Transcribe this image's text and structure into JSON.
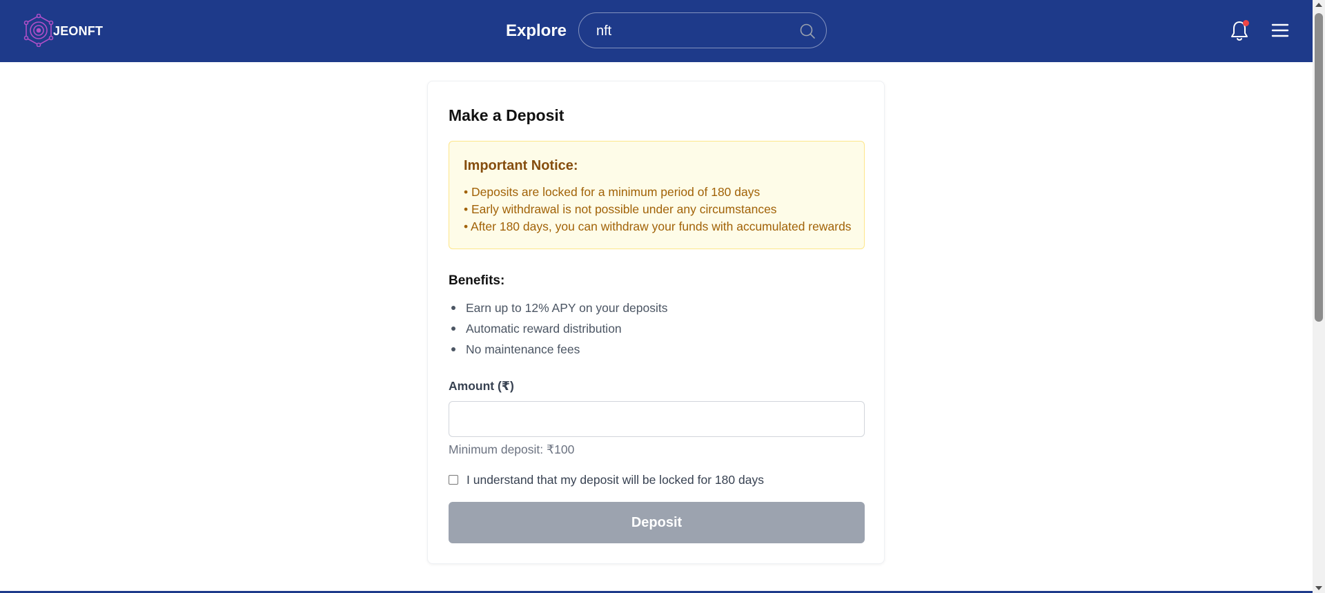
{
  "header": {
    "brand": "JEONFT",
    "explore_label": "Explore",
    "search": {
      "value": "nft",
      "placeholder": ""
    }
  },
  "deposit_card": {
    "title": "Make a Deposit",
    "notice": {
      "title": "Important Notice:",
      "lines": [
        "• Deposits are locked for a minimum period of 180 days",
        "• Early withdrawal is not possible under any circumstances",
        "• After 180 days, you can withdraw your funds with accumulated rewards"
      ]
    },
    "benefits": {
      "title": "Benefits:",
      "items": [
        "Earn up to 12% APY on your deposits",
        "Automatic reward distribution",
        "No maintenance fees"
      ]
    },
    "amount": {
      "label": "Amount (₹)",
      "value": "",
      "hint": "Minimum deposit: ₹100"
    },
    "agreement": {
      "label": "I understand that my deposit will be locked for 180 days",
      "checked": false
    },
    "deposit_button": "Deposit"
  },
  "colors": {
    "header_bg": "#1e3a8a",
    "notice_bg": "#fefce8",
    "notice_text": "#a16207",
    "button_disabled": "#9ca3af",
    "notification_dot": "#ef4444"
  },
  "icons": [
    "logo-icon",
    "search-icon",
    "bell-icon",
    "menu-icon"
  ]
}
